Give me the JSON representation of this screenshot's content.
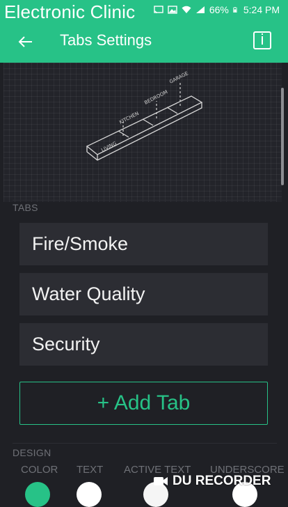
{
  "overlay": {
    "channel_title": "Electronic Clinic"
  },
  "status_bar": {
    "battery": "66%",
    "time": "5:24 PM"
  },
  "app_bar": {
    "title": "Tabs Settings"
  },
  "illustration": {
    "labels": [
      "LIVING",
      "KITCHEN",
      "BEDROOM",
      "GARAGE"
    ]
  },
  "tabs_section": {
    "label": "TABS",
    "items": [
      {
        "label": "Fire/Smoke"
      },
      {
        "label": "Water Quality"
      },
      {
        "label": "Security"
      }
    ],
    "add_button": "+ Add Tab"
  },
  "design_section": {
    "label": "DESIGN",
    "columns": [
      "COLOR",
      "TEXT",
      "ACTIVE TEXT",
      "UNDERSCORE"
    ],
    "swatches": [
      "#27c287",
      "#ffffff",
      "#f5f5f5",
      "#ffffff"
    ]
  },
  "watermark": {
    "text": "DU RECORDER"
  },
  "colors": {
    "accent": "#27c287",
    "background": "#1f2025",
    "row": "#2c2d33"
  }
}
